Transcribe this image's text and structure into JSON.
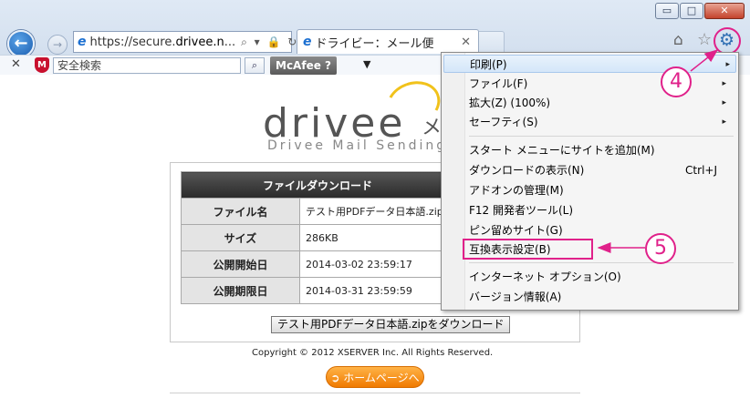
{
  "window": {
    "minimize_glyph": "▭",
    "maximize_glyph": "□",
    "close_glyph": "✕"
  },
  "nav": {
    "back_glyph": "←",
    "forward_glyph": "→",
    "address": {
      "scheme": "https://secure.",
      "host": "drivee.n",
      "ellipsis": "...",
      "icons": "⌕ ▾ 🔒 ↻"
    }
  },
  "tab": {
    "title": "ドライビー：メール便",
    "close_glyph": "✕"
  },
  "toolbar_icons": {
    "home": "⌂",
    "favorites": "☆",
    "tools": "⚙"
  },
  "command_bar": {
    "stop_glyph": "✕",
    "search_placeholder": "安全検索",
    "search_glyph": "⌕",
    "mcafee_label": "McAfee ",
    "mcafee_help": "?",
    "mcafee_dropdown": "▼"
  },
  "page": {
    "logo": "drivee",
    "logo_tail": "メ",
    "tagline": "Drivee Mail Sending",
    "table": {
      "header": "ファイルダウンロード",
      "rows": [
        {
          "key": "ファイル名",
          "value": "テスト用PDFデータ日本語.zip"
        },
        {
          "key": "サイズ",
          "value": "286KB"
        },
        {
          "key": "公開開始日",
          "value": "2014-03-02 23:59:17"
        },
        {
          "key": "公開期限日",
          "value": "2014-03-31 23:59:59"
        }
      ]
    },
    "download_button": "テスト用PDFデータ日本語.zipをダウンロード",
    "copyright": "Copyright © 2012 XSERVER Inc. All Rights Reserved.",
    "home_button": "➲ ホームページへ"
  },
  "menu": {
    "items": [
      {
        "label": "印刷(P)",
        "submenu": "▸"
      },
      {
        "label": "ファイル(F)",
        "submenu": "▸"
      },
      {
        "label": "拡大(Z) (100%)",
        "submenu": "▸"
      },
      {
        "label": "セーフティ(S)",
        "submenu": "▸"
      },
      {
        "label": "スタート メニューにサイトを追加(M)"
      },
      {
        "label": "ダウンロードの表示(N)",
        "shortcut": "Ctrl+J"
      },
      {
        "label": "アドオンの管理(M)"
      },
      {
        "label": "F12 開発者ツール(L)"
      },
      {
        "label": "ピン留めサイト(G)"
      },
      {
        "label": "互換表示設定(B)"
      },
      {
        "label": "インターネット オプション(O)"
      },
      {
        "label": "バージョン情報(A)"
      }
    ]
  },
  "annotations": {
    "step4": "4",
    "step5": "5",
    "accent_color": "#e0218a"
  }
}
